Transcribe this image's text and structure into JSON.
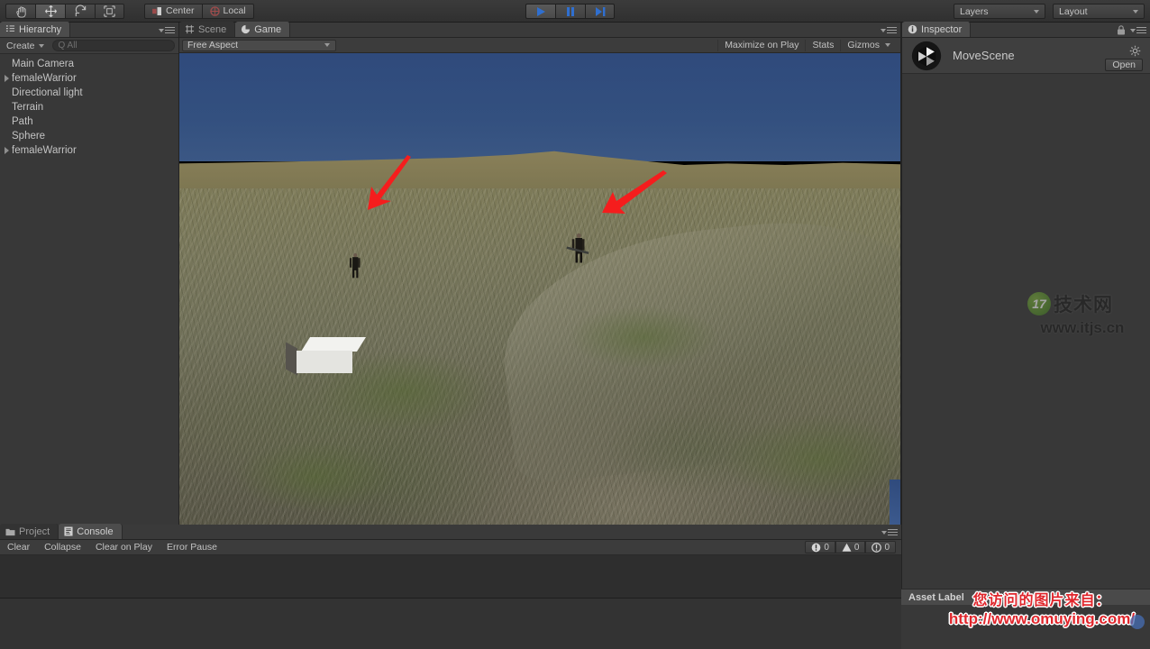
{
  "toolbar": {
    "tools": [
      {
        "name": "hand-tool",
        "icon": "hand-icon",
        "selected": false
      },
      {
        "name": "move-tool",
        "icon": "move-icon",
        "selected": true
      },
      {
        "name": "rotate-tool",
        "icon": "rotate-icon",
        "selected": false
      },
      {
        "name": "scale-tool",
        "icon": "scale-icon",
        "selected": false
      }
    ],
    "pivot_label": "Center",
    "space_label": "Local",
    "play_label": "play-icon",
    "pause_label": "pause-icon",
    "step_label": "step-icon",
    "layers_label": "Layers",
    "layout_label": "Layout",
    "accent_play": "#2f6fd0"
  },
  "hierarchy": {
    "tab_label": "Hierarchy",
    "create_label": "Create",
    "search_placeholder": "Q All",
    "search_value": "",
    "items": [
      {
        "label": "Main Camera",
        "expandable": false
      },
      {
        "label": "femaleWarrior",
        "expandable": true
      },
      {
        "label": "Directional light",
        "expandable": false
      },
      {
        "label": "Terrain",
        "expandable": false
      },
      {
        "label": "Path",
        "expandable": false
      },
      {
        "label": "Sphere",
        "expandable": false
      },
      {
        "label": "femaleWarrior",
        "expandable": true
      }
    ]
  },
  "gameview": {
    "tabs": [
      {
        "label": "Scene",
        "icon": "grid-icon",
        "active": false
      },
      {
        "label": "Game",
        "icon": "gamepad-icon",
        "active": true
      }
    ],
    "aspect_label": "Free Aspect",
    "maximize_label": "Maximize on Play",
    "stats_label": "Stats",
    "gizmos_label": "Gizmos",
    "scene_description": "3D terrain with blue sky, two female warrior characters, a white box, and two red annotation arrows",
    "annotations": [
      {
        "name": "red-arrow-left",
        "points_to": "warrior-1"
      },
      {
        "name": "red-arrow-right",
        "points_to": "warrior-2"
      }
    ],
    "colors": {
      "sky": "#334f80",
      "terrain": "#77765a",
      "arrow": "#f51d1d",
      "box": "#f2f2ef"
    }
  },
  "inspector": {
    "tab_label": "Inspector",
    "asset_name": "MoveScene",
    "open_label": "Open",
    "asset_label_title": "Asset Label"
  },
  "console": {
    "tabs": [
      {
        "label": "Project",
        "icon": "folder-icon",
        "active": false
      },
      {
        "label": "Console",
        "icon": "console-icon",
        "active": true
      }
    ],
    "buttons": [
      "Clear",
      "Collapse",
      "Clear on Play",
      "Error Pause"
    ],
    "counters": [
      {
        "name": "error-count",
        "icon": "error-icon",
        "value": "0"
      },
      {
        "name": "warning-count",
        "icon": "warning-icon",
        "value": "0"
      },
      {
        "name": "info-count",
        "icon": "info-icon",
        "value": "0"
      }
    ]
  },
  "watermarks": {
    "itjs_badge": "17",
    "itjs_cn": "技术网",
    "itjs_url": "www.itjs.cn",
    "red_line1": "您访问的图片来自：",
    "red_line2": "http://www.omuying.com/"
  }
}
